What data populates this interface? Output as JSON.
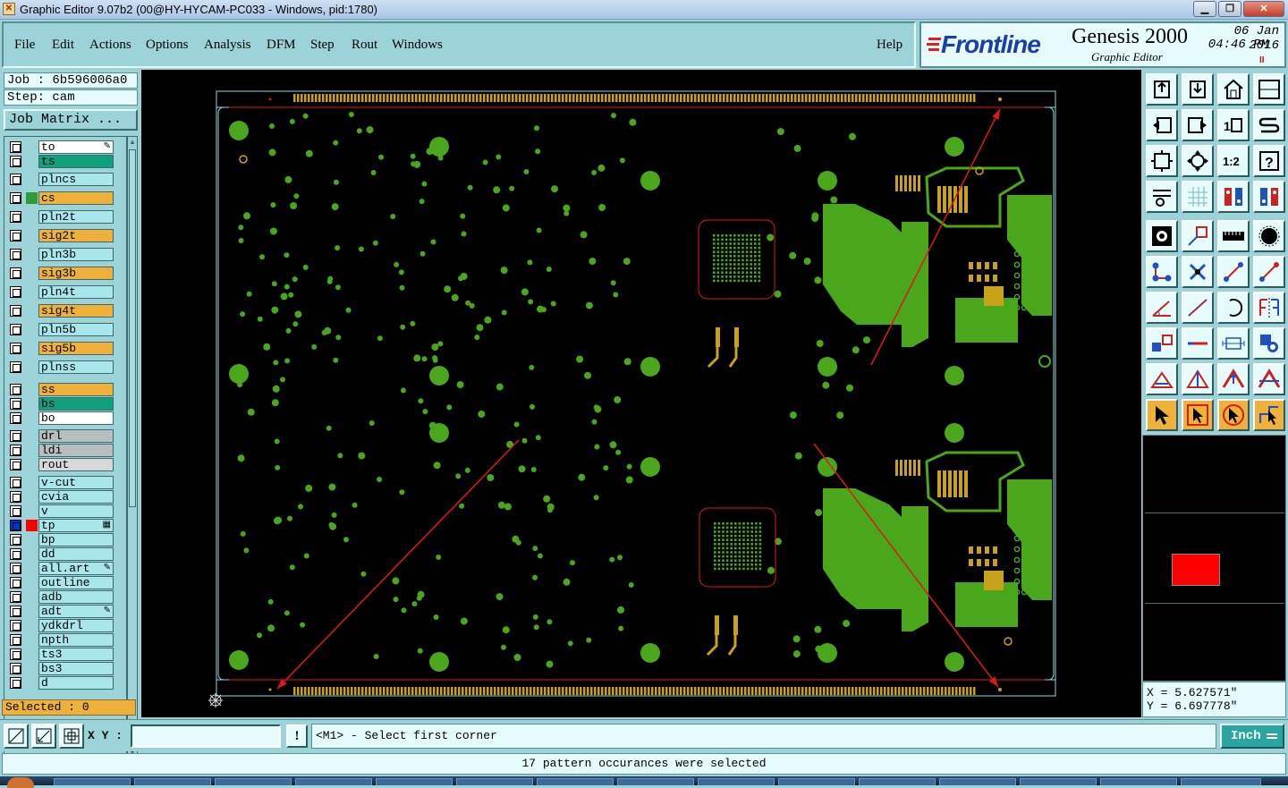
{
  "window": {
    "title": "Graphic Editor 9.07b2 (00@HY-HYCAM-PC033 - Windows, pid:1780)",
    "controls": [
      "minimize",
      "maximize",
      "close"
    ]
  },
  "menu": {
    "items": [
      "File",
      "Edit",
      "Actions",
      "Options",
      "Analysis",
      "DFM",
      "Step",
      "Rout",
      "Windows"
    ],
    "help": "Help"
  },
  "brand": {
    "logo": "Frontline",
    "product": "Genesis 2000",
    "subtitle": "Graphic Editor",
    "date": "06 Jan 2016",
    "time": "04:46 PM",
    "pause_glyph": "II"
  },
  "job": {
    "job_line": "Job : 6b596006a0",
    "step_line": "Step: cam",
    "matrix_button": "Job Matrix ..."
  },
  "layers": [
    {
      "name": "to",
      "color": "#ffffff",
      "mark": "pen"
    },
    {
      "name": "ts",
      "color": "#10a07c"
    },
    {
      "name": "plncs",
      "color": "#a8e6ec"
    },
    {
      "name": "cs",
      "color": "#f0b13a",
      "swatch": "#2e9a3a"
    },
    {
      "name": "pln2t",
      "color": "#a8e6ec"
    },
    {
      "name": "sig2t",
      "color": "#f0b13a"
    },
    {
      "name": "pln3b",
      "color": "#a8e6ec"
    },
    {
      "name": "sig3b",
      "color": "#f0b13a"
    },
    {
      "name": "pln4t",
      "color": "#a8e6ec"
    },
    {
      "name": "sig4t",
      "color": "#f0b13a"
    },
    {
      "name": "pln5b",
      "color": "#a8e6ec"
    },
    {
      "name": "sig5b",
      "color": "#f0b13a"
    },
    {
      "name": "plnss",
      "color": "#a8e6ec"
    },
    {
      "name": "ss",
      "color": "#f0b13a"
    },
    {
      "name": "bs",
      "color": "#10a07c"
    },
    {
      "name": "bo",
      "color": "#ffffff"
    },
    {
      "name": "drl",
      "color": "#b8bec0"
    },
    {
      "name": "ldi",
      "color": "#b8bec0"
    },
    {
      "name": "rout",
      "color": "#d8d8d8"
    },
    {
      "name": "v-cut",
      "color": "#a8e6ec"
    },
    {
      "name": "cvia",
      "color": "#a8e6ec"
    },
    {
      "name": "v",
      "color": "#a8e6ec"
    },
    {
      "name": "tp",
      "color": "#a8e6ec",
      "swatch": "#ff0000",
      "active": true,
      "mark": "grid"
    },
    {
      "name": "bp",
      "color": "#a8e6ec"
    },
    {
      "name": "dd",
      "color": "#a8e6ec"
    },
    {
      "name": "all.art",
      "color": "#a8e6ec",
      "mark": "pen"
    },
    {
      "name": "outline",
      "color": "#a8e6ec"
    },
    {
      "name": "adb",
      "color": "#a8e6ec"
    },
    {
      "name": "adt",
      "color": "#a8e6ec",
      "mark": "pen"
    },
    {
      "name": "ydkdrl",
      "color": "#a8e6ec"
    },
    {
      "name": "npth",
      "color": "#a8e6ec"
    },
    {
      "name": "ts3",
      "color": "#a8e6ec"
    },
    {
      "name": "bs3",
      "color": "#a8e6ec"
    },
    {
      "name": "d",
      "color": "#a8e6ec"
    }
  ],
  "selected": "Selected : 0",
  "tools": [
    {
      "icon": "layer-up-icon"
    },
    {
      "icon": "layer-down-icon"
    },
    {
      "icon": "home-icon"
    },
    {
      "icon": "window-split-icon"
    },
    {
      "icon": "pan-left-icon"
    },
    {
      "icon": "pan-right-icon"
    },
    {
      "icon": "zoom-10-icon"
    },
    {
      "icon": "snap-s-icon"
    },
    {
      "icon": "zoom-fit-icon"
    },
    {
      "icon": "zoom-profile-icon"
    },
    {
      "icon": "zoom-1to2-icon",
      "text": "1:2"
    },
    {
      "icon": "help-question-icon"
    },
    {
      "icon": "measure-tool-icon"
    },
    {
      "icon": "grid-icon"
    },
    {
      "icon": "layers-display-icon"
    },
    {
      "icon": "layers-display-alt-icon"
    },
    {
      "icon": "pad-select-icon"
    },
    {
      "icon": "line-rect-icon"
    },
    {
      "icon": "ruler-icon"
    },
    {
      "icon": "circle-pad-icon"
    },
    {
      "icon": "connect-nodes-icon"
    },
    {
      "icon": "delete-node-icon"
    },
    {
      "icon": "line-segment-icon"
    },
    {
      "icon": "line-segment-alt-icon"
    },
    {
      "icon": "angle-line-icon"
    },
    {
      "icon": "diagonal-line-icon"
    },
    {
      "icon": "arc-icon"
    },
    {
      "icon": "mirror-f-icon"
    },
    {
      "icon": "move-pad-icon"
    },
    {
      "icon": "horizontal-line-icon"
    },
    {
      "icon": "dimension-icon"
    },
    {
      "icon": "copy-shapes-icon"
    },
    {
      "icon": "triangle-measure-icon"
    },
    {
      "icon": "triangle-alt-icon"
    },
    {
      "icon": "triangle-up-icon"
    },
    {
      "icon": "triangle-split-icon"
    },
    {
      "icon": "pointer-icon"
    },
    {
      "icon": "pointer-select-icon"
    },
    {
      "icon": "pointer-rotate-icon"
    },
    {
      "icon": "pointer-route-icon"
    }
  ],
  "coords": {
    "x": "X = 5.627571\"",
    "y": "Y = 6.697778\""
  },
  "bottom": {
    "xy_label": "X Y :",
    "xy_value": "",
    "warn_glyph": "!",
    "prompt": "<M1> - Select first corner",
    "units": "Inch"
  },
  "status": "17 pattern occurances were selected"
}
